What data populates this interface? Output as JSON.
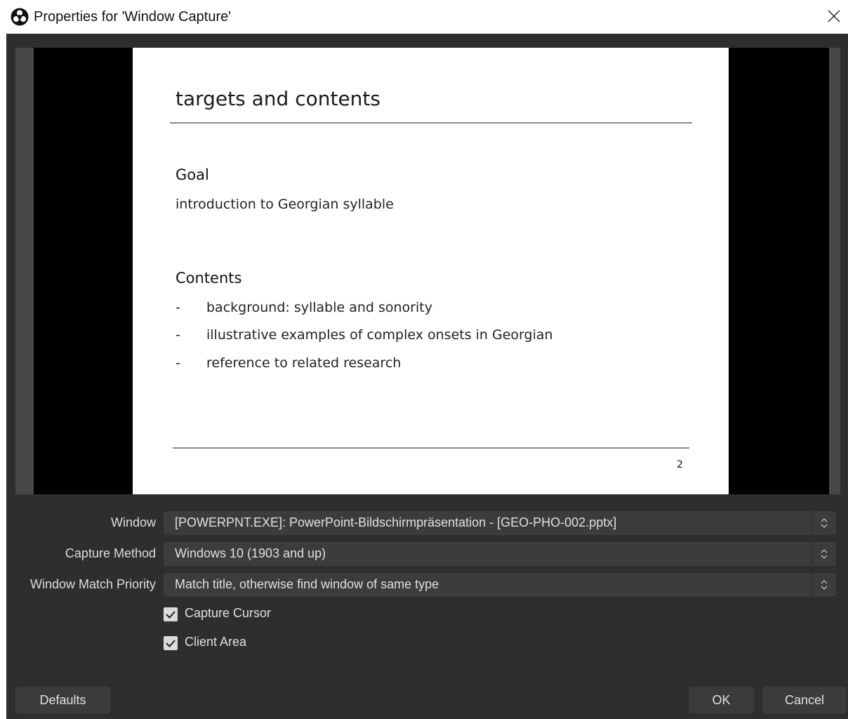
{
  "window": {
    "title": "Properties for 'Window Capture'",
    "app_icon": "obs-icon",
    "close_icon": "close-icon"
  },
  "preview": {
    "slide": {
      "title": "targets and contents",
      "goal_heading": "Goal",
      "goal_text": "introduction to Georgian syllable",
      "contents_heading": "Contents",
      "bullets": [
        {
          "dash": "-",
          "text": "background: syllable and sonority"
        },
        {
          "dash": "-",
          "text": "illustrative examples of complex onsets in Georgian"
        },
        {
          "dash": "-",
          "text": "reference to related research"
        }
      ],
      "page_number": "2"
    }
  },
  "form": {
    "window_label": "Window",
    "window_value": "[POWERPNT.EXE]: PowerPoint-Bildschirmpräsentation - [GEO-PHO-002.pptx]",
    "capture_method_label": "Capture Method",
    "capture_method_value": "Windows 10 (1903 and up)",
    "match_priority_label": "Window Match Priority",
    "match_priority_value": "Match title, otherwise find window of same type",
    "capture_cursor_label": "Capture Cursor",
    "capture_cursor_checked": true,
    "client_area_label": "Client Area",
    "client_area_checked": true
  },
  "buttons": {
    "defaults": "Defaults",
    "ok": "OK",
    "cancel": "Cancel"
  },
  "colors": {
    "dialog_bg": "#2e2e2e",
    "control_bg": "#3c3c3c",
    "text": "#e0e0e0"
  }
}
